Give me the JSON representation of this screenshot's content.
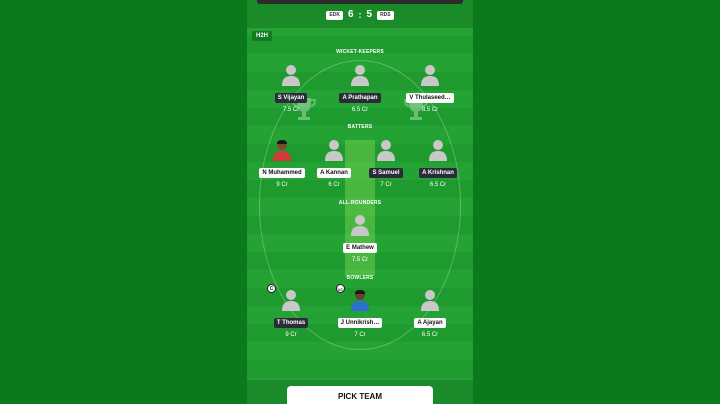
{
  "header": {
    "team1": "EDK",
    "score1": "6",
    "separator": ":",
    "score2": "5",
    "team2": "RDS"
  },
  "h2h_label": "H2H",
  "sections": {
    "wicket_keepers": "WICKET-KEEPERS",
    "batters": "BATTERS",
    "all_rounders": "ALL-ROUNDERS",
    "bowlers": "BOWLERS"
  },
  "wicket_keepers": [
    {
      "name": "S Vijayan",
      "credit": "7.5 Cr"
    },
    {
      "name": "A Prathapan",
      "credit": "6.5 Cr"
    },
    {
      "name": "V Thulaseed…",
      "credit": "8.5 Cr"
    }
  ],
  "batters": [
    {
      "name": "N Muhammed",
      "credit": "9 Cr"
    },
    {
      "name": "A Kannan",
      "credit": "6 Cr"
    },
    {
      "name": "S Samuel",
      "credit": "7 Cr"
    },
    {
      "name": "A Krishnan",
      "credit": "6.5 Cr"
    }
  ],
  "all_rounders": [
    {
      "name": "E Mathew",
      "credit": "7.5 Cr"
    }
  ],
  "bowlers": [
    {
      "name": "T Thomas",
      "credit": "9 Cr"
    },
    {
      "name": "J Unnikrish…",
      "credit": "7 Cr"
    },
    {
      "name": "A Ajayan",
      "credit": "6.5 Cr"
    }
  ],
  "captain_badge": "C",
  "vice_captain_badge": "VC",
  "pick_team_label": "PICK TEAM"
}
